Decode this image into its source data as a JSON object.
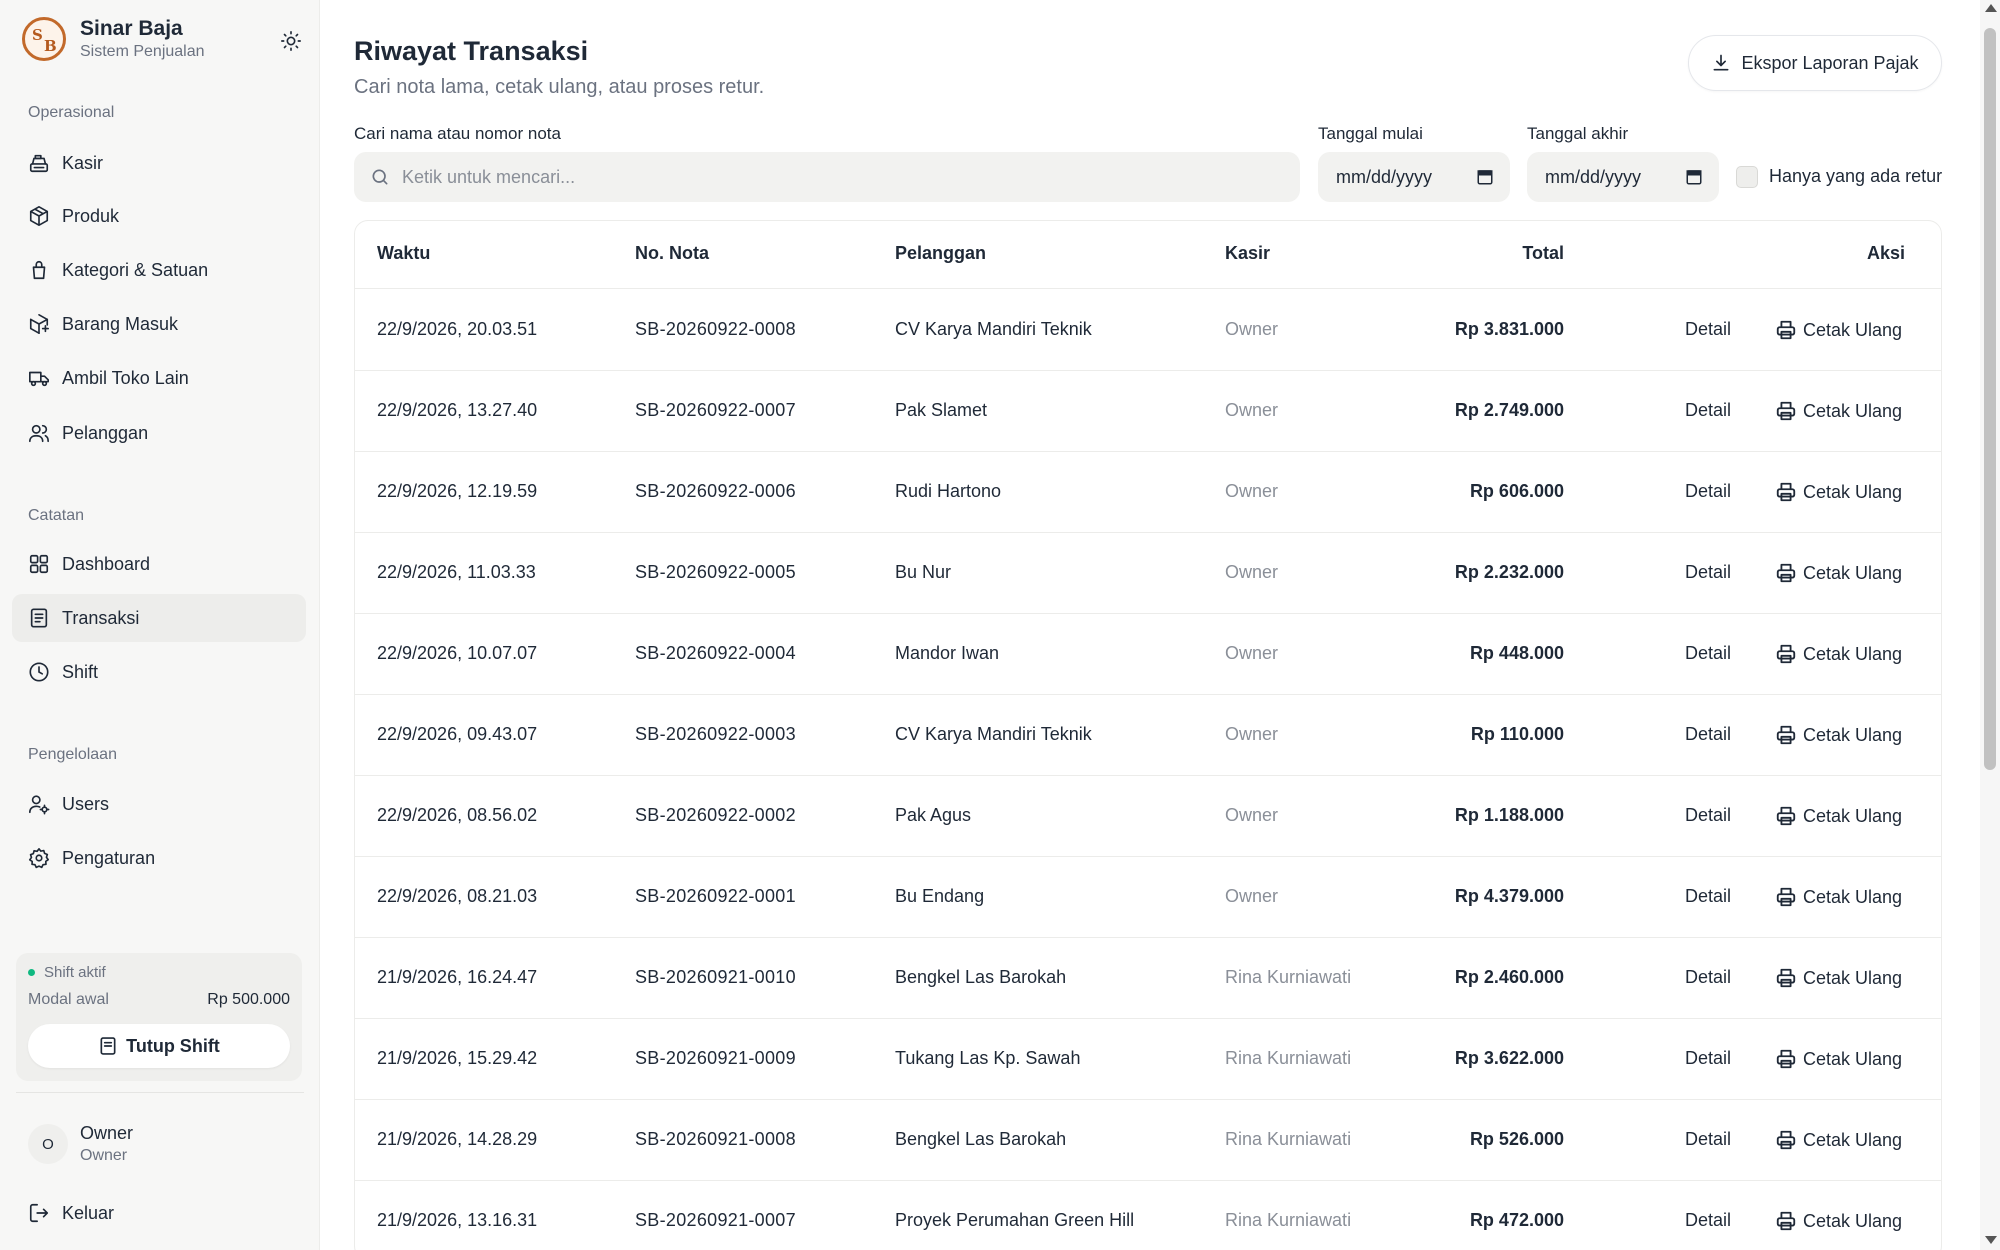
{
  "brand": {
    "name": "Sinar Baja",
    "subtitle": "Sistem Penjualan",
    "logo_letter_1": "S",
    "logo_letter_2": "B"
  },
  "sidebar": {
    "sections": [
      {
        "label": "Operasional"
      },
      {
        "label": "Catatan"
      },
      {
        "label": "Pengelolaan"
      }
    ],
    "items": [
      {
        "label": "Kasir",
        "icon": "cash-register-icon"
      },
      {
        "label": "Produk",
        "icon": "package-icon"
      },
      {
        "label": "Kategori & Satuan",
        "icon": "tag-icon"
      },
      {
        "label": "Barang Masuk",
        "icon": "package-in-icon"
      },
      {
        "label": "Ambil Toko Lain",
        "icon": "truck-icon"
      },
      {
        "label": "Pelanggan",
        "icon": "users-icon"
      },
      {
        "label": "Dashboard",
        "icon": "grid-icon"
      },
      {
        "label": "Transaksi",
        "icon": "receipt-icon",
        "active": true
      },
      {
        "label": "Shift",
        "icon": "clock-icon"
      },
      {
        "label": "Users",
        "icon": "user-gear-icon"
      },
      {
        "label": "Pengaturan",
        "icon": "gear-icon"
      }
    ],
    "shift": {
      "status": "Shift aktif",
      "modal_label": "Modal awal",
      "modal_value": "Rp 500.000",
      "close_label": "Tutup Shift"
    },
    "user": {
      "initial": "O",
      "name": "Owner",
      "role": "Owner"
    },
    "logout_label": "Keluar"
  },
  "header": {
    "title": "Riwayat Transaksi",
    "subtitle": "Cari nota lama, cetak ulang, atau proses retur.",
    "export_label": "Ekspor Laporan Pajak"
  },
  "filters": {
    "search_label": "Cari nama atau nomor nota",
    "search_placeholder": "Ketik untuk mencari...",
    "start_label": "Tanggal mulai",
    "end_label": "Tanggal akhir",
    "date_placeholder": "mm/dd/yyyy",
    "retur_label": "Hanya yang ada retur"
  },
  "table": {
    "columns": [
      "Waktu",
      "No. Nota",
      "Pelanggan",
      "Kasir",
      "Total",
      "Aksi"
    ],
    "detail_label": "Detail",
    "reprint_label": "Cetak Ulang",
    "rows": [
      {
        "waktu": "22/9/2026, 20.03.51",
        "nota": "SB-20260922-0008",
        "pelanggan": "CV Karya Mandiri Teknik",
        "kasir": "Owner",
        "total": "Rp 3.831.000"
      },
      {
        "waktu": "22/9/2026, 13.27.40",
        "nota": "SB-20260922-0007",
        "pelanggan": "Pak Slamet",
        "kasir": "Owner",
        "total": "Rp 2.749.000"
      },
      {
        "waktu": "22/9/2026, 12.19.59",
        "nota": "SB-20260922-0006",
        "pelanggan": "Rudi Hartono",
        "kasir": "Owner",
        "total": "Rp 606.000"
      },
      {
        "waktu": "22/9/2026, 11.03.33",
        "nota": "SB-20260922-0005",
        "pelanggan": "Bu Nur",
        "kasir": "Owner",
        "total": "Rp 2.232.000"
      },
      {
        "waktu": "22/9/2026, 10.07.07",
        "nota": "SB-20260922-0004",
        "pelanggan": "Mandor Iwan",
        "kasir": "Owner",
        "total": "Rp 448.000"
      },
      {
        "waktu": "22/9/2026, 09.43.07",
        "nota": "SB-20260922-0003",
        "pelanggan": "CV Karya Mandiri Teknik",
        "kasir": "Owner",
        "total": "Rp 110.000"
      },
      {
        "waktu": "22/9/2026, 08.56.02",
        "nota": "SB-20260922-0002",
        "pelanggan": "Pak Agus",
        "kasir": "Owner",
        "total": "Rp 1.188.000"
      },
      {
        "waktu": "22/9/2026, 08.21.03",
        "nota": "SB-20260922-0001",
        "pelanggan": "Bu Endang",
        "kasir": "Owner",
        "total": "Rp 4.379.000"
      },
      {
        "waktu": "21/9/2026, 16.24.47",
        "nota": "SB-20260921-0010",
        "pelanggan": "Bengkel Las Barokah",
        "kasir": "Rina Kurniawati",
        "total": "Rp 2.460.000"
      },
      {
        "waktu": "21/9/2026, 15.29.42",
        "nota": "SB-20260921-0009",
        "pelanggan": "Tukang Las Kp. Sawah",
        "kasir": "Rina Kurniawati",
        "total": "Rp 3.622.000"
      },
      {
        "waktu": "21/9/2026, 14.28.29",
        "nota": "SB-20260921-0008",
        "pelanggan": "Bengkel Las Barokah",
        "kasir": "Rina Kurniawati",
        "total": "Rp 526.000"
      },
      {
        "waktu": "21/9/2026, 13.16.31",
        "nota": "SB-20260921-0007",
        "pelanggan": "Proyek Perumahan Green Hill",
        "kasir": "Rina Kurniawati",
        "total": "Rp 472.000"
      }
    ]
  },
  "colors": {
    "accent": "#c2692a",
    "active_dot": "#10b981",
    "muted_text": "#6b7280",
    "sidebar_bg": "#f7f7f6"
  }
}
